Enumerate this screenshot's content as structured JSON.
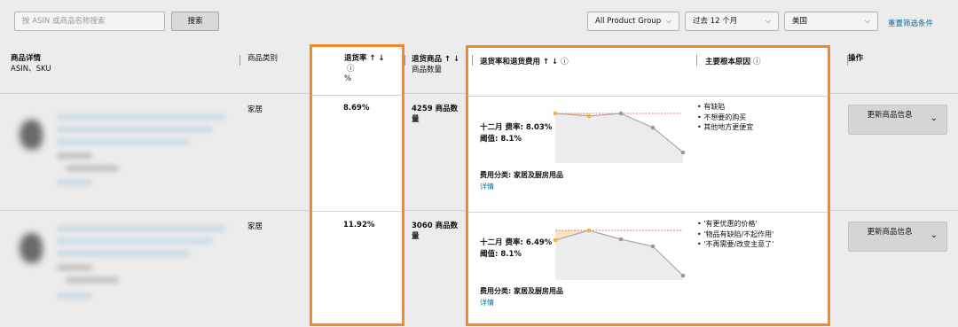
{
  "toolbar": {
    "search_placeholder": "按 ASIN 或商品名称搜索",
    "search_button": "搜索",
    "product_group": "All Product Group",
    "period": "过去 12 个月",
    "country": "美国",
    "reset_link": "重置筛选条件"
  },
  "columns": {
    "details": "商品详情",
    "details_sub": "ASIN、SKU",
    "category": "商品类别",
    "return_rate": "退货率 ↑ ↓",
    "return_rate_unit": "%",
    "return_qty": "退货商品 ↑ ↓",
    "return_qty_sub": "商品数量",
    "rate_fee": "退货率和退货费用 ↑ ↓",
    "root_cause": "主要根本原因",
    "actions": "操作"
  },
  "rows": [
    {
      "category": "家居",
      "return_rate": "8.69%",
      "return_qty": "4259 商品数量",
      "current_rate": "十二月 费率: 8.03%",
      "threshold": "阈值: 8.1%",
      "fee_category": "费用分类: 家居及厨房用品",
      "detail_link": "详情",
      "reasons": [
        "有缺陷",
        "不想要的购买",
        "其他地方更便宜"
      ],
      "action": "更新商品信息"
    },
    {
      "category": "家居",
      "return_rate": "11.92%",
      "return_qty": "3060 商品数量",
      "current_rate": "十二月 费率: 6.49%",
      "threshold": "阈值: 8.1%",
      "fee_category": "费用分类: 家居及厨房用品",
      "detail_link": "详情",
      "reasons": [
        "'有更优惠的价格'",
        "'物品有缺陷/不起作用'",
        "'不再需要/改变主意了'"
      ],
      "action": "更新商品信息"
    }
  ],
  "colors": {
    "highlight": "#f08a2c",
    "link": "#0a6f9a",
    "trend_point": "#f2b233",
    "threshold_line": "#d9534f"
  }
}
